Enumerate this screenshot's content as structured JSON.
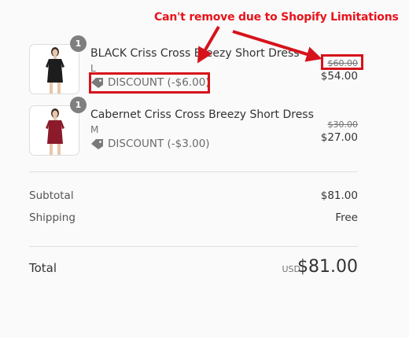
{
  "annotation": {
    "text": "Can't remove due to Shopify Limitations",
    "color": "#e8141b"
  },
  "line_items": [
    {
      "quantity": "1",
      "name": "BLACK Criss Cross Breezy Short Dress",
      "variant": "L",
      "discount": "DISCOUNT (-$6.00)",
      "original_price": "$60.00",
      "final_price": "$54.00",
      "dress_color": "#1d1d1d"
    },
    {
      "quantity": "1",
      "name": "Cabernet Criss Cross Breezy Short Dress",
      "variant": "M",
      "discount": "DISCOUNT (-$3.00)",
      "original_price": "$30.00",
      "final_price": "$27.00",
      "dress_color": "#8b1a2b"
    }
  ],
  "summary": {
    "subtotal_label": "Subtotal",
    "subtotal_value": "$81.00",
    "shipping_label": "Shipping",
    "shipping_value": "Free",
    "total_label": "Total",
    "currency": "USD",
    "total_value": "$81.00"
  },
  "icons": {
    "discount": "tag-icon"
  }
}
